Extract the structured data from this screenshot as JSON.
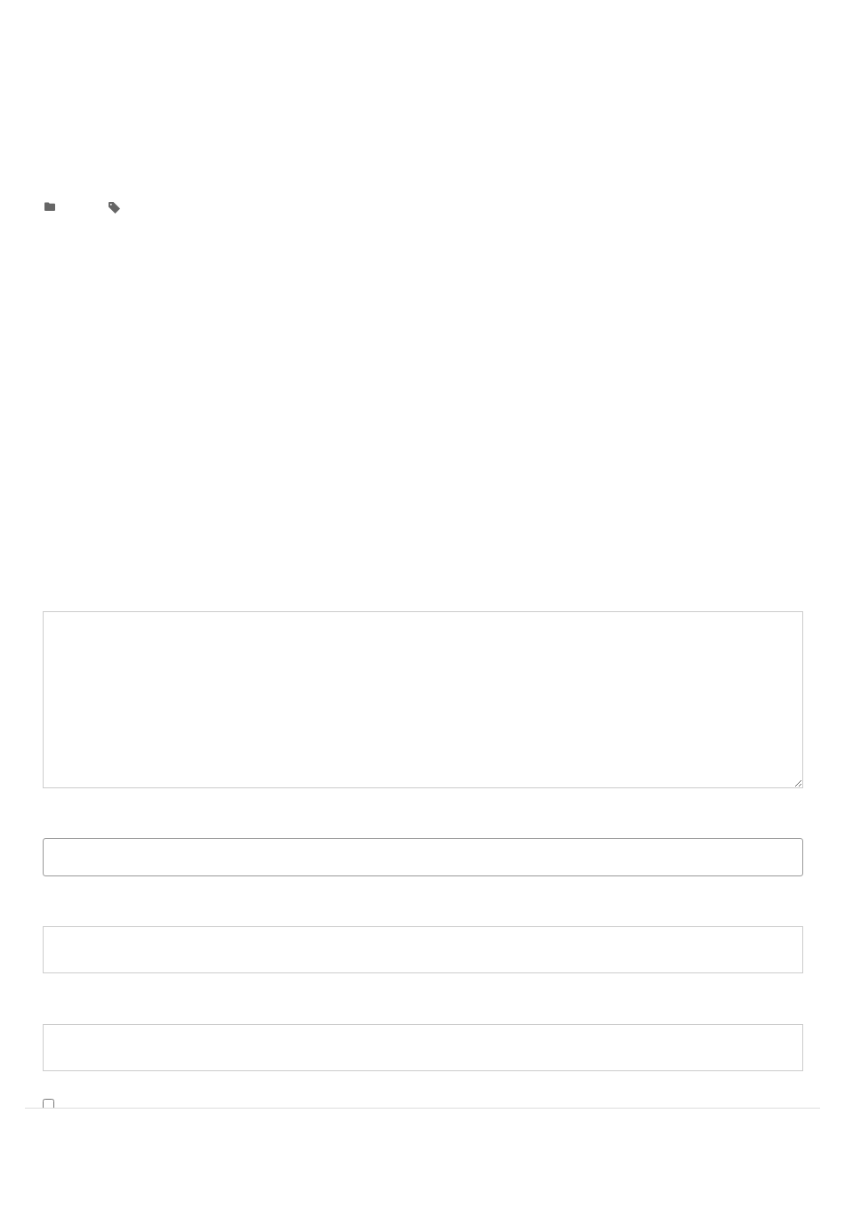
{
  "comment_form": {
    "fields": [
      {
        "kind": "textarea"
      },
      {
        "kind": "select"
      },
      {
        "kind": "text"
      },
      {
        "kind": "text"
      }
    ],
    "consent": {
      "checked": false
    }
  }
}
